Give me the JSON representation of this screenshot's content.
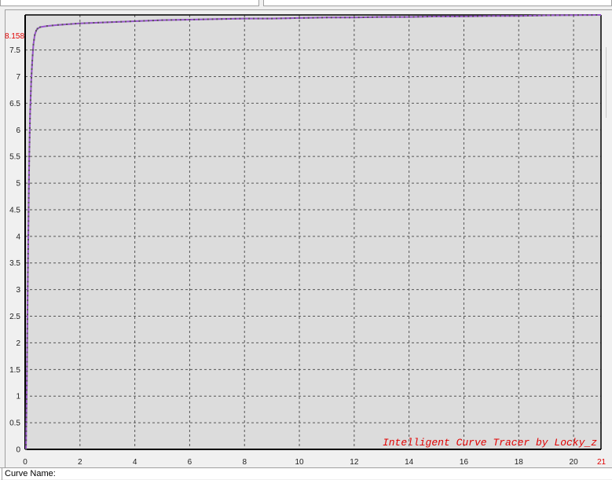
{
  "watermark": "Intelligent Curve Tracer by Locky_z",
  "status": {
    "curve_name_label": "Curve Name:"
  },
  "colors": {
    "plot_bg": "#dcdcdc",
    "grid": "#555555",
    "axis": "#000000",
    "curve": "#9955cc",
    "marker": "#555555",
    "accent": "#e00000"
  },
  "chart_data": {
    "type": "line",
    "xlim": [
      0,
      21
    ],
    "ylim": [
      0,
      8.158
    ],
    "x_ticks": [
      0,
      2,
      4,
      6,
      8,
      10,
      12,
      14,
      16,
      18,
      20
    ],
    "x_tick_labels": [
      "0",
      "2",
      "4",
      "6",
      "8",
      "10",
      "12",
      "14",
      "16",
      "18",
      "20"
    ],
    "y_ticks": [
      0,
      0.5,
      1,
      1.5,
      2,
      2.5,
      3,
      3.5,
      4,
      4.5,
      5,
      5.5,
      6,
      6.5,
      7,
      7.5
    ],
    "y_tick_labels": [
      "0",
      "0.5",
      "1",
      "1.5",
      "2",
      "2.5",
      "3",
      "3.5",
      "4",
      "4.5",
      "5",
      "5.5",
      "6",
      "6.5",
      "7",
      "7.5"
    ],
    "x_max_label": "21",
    "y_max_label": "8.158",
    "grid": true,
    "series": [
      {
        "x": [
          0.03,
          0.06,
          0.09,
          0.12,
          0.15,
          0.18,
          0.22,
          0.26,
          0.3,
          0.35,
          0.4,
          0.45,
          0.55,
          0.8,
          1.2,
          2,
          3,
          4,
          5,
          6,
          7,
          8,
          9,
          10,
          11,
          12,
          13,
          14,
          15,
          16,
          17,
          18,
          19,
          20,
          21
        ],
        "y": [
          0,
          1.2,
          2.8,
          4.2,
          5.5,
          6.3,
          6.9,
          7.3,
          7.6,
          7.78,
          7.86,
          7.9,
          7.93,
          7.95,
          7.97,
          8.0,
          8.02,
          8.04,
          8.06,
          8.07,
          8.08,
          8.09,
          8.09,
          8.1,
          8.11,
          8.11,
          8.12,
          8.12,
          8.13,
          8.13,
          8.14,
          8.14,
          8.15,
          8.155,
          8.158
        ]
      }
    ]
  }
}
